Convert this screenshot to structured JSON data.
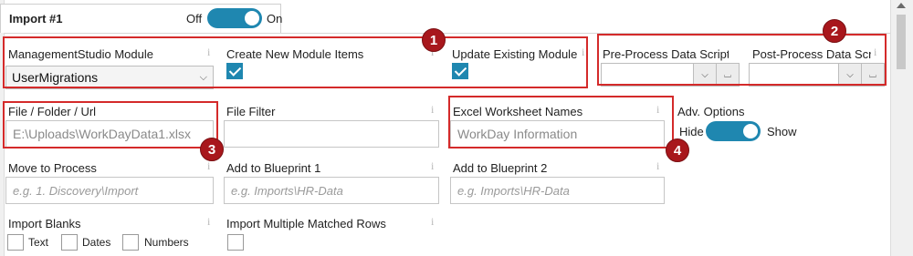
{
  "tab": {
    "title": "Import #1",
    "toggle_off": "Off",
    "toggle_on": "On"
  },
  "colors": {
    "accent": "#1f87b0",
    "callout": "#a8171c",
    "highlight": "#d42a2a"
  },
  "info_icon": "i",
  "fields": {
    "module": {
      "label": "ManagementStudio Module",
      "value": "UserMigrations"
    },
    "create_new": {
      "label": "Create New Module Items",
      "checked": true
    },
    "update_existing": {
      "label": "Update Existing Module",
      "checked": true
    },
    "pre_process": {
      "label": "Pre-Process Data Scriptlet"
    },
    "post_process": {
      "label": "Post-Process Data Script"
    },
    "file": {
      "label": "File / Folder / Url",
      "value": "E:\\Uploads\\WorkDayData1.xlsx"
    },
    "file_filter": {
      "label": "File Filter",
      "value": ""
    },
    "worksheet": {
      "label": "Excel Worksheet Names",
      "value": "WorkDay Information"
    },
    "adv_options": {
      "label": "Adv. Options",
      "hide": "Hide",
      "show": "Show"
    },
    "move_to_process": {
      "label": "Move to Process",
      "placeholder": "e.g. 1. Discovery\\Import"
    },
    "blueprint1": {
      "label": "Add to Blueprint 1",
      "placeholder": "e.g. Imports\\HR-Data"
    },
    "blueprint2": {
      "label": "Add to Blueprint 2",
      "placeholder": "e.g. Imports\\HR-Data"
    },
    "import_blanks": {
      "label": "Import Blanks",
      "options": [
        "Text",
        "Dates",
        "Numbers"
      ]
    },
    "multiple_matched": {
      "label": "Import Multiple Matched Rows"
    }
  },
  "callouts": [
    "1",
    "2",
    "3",
    "4"
  ]
}
